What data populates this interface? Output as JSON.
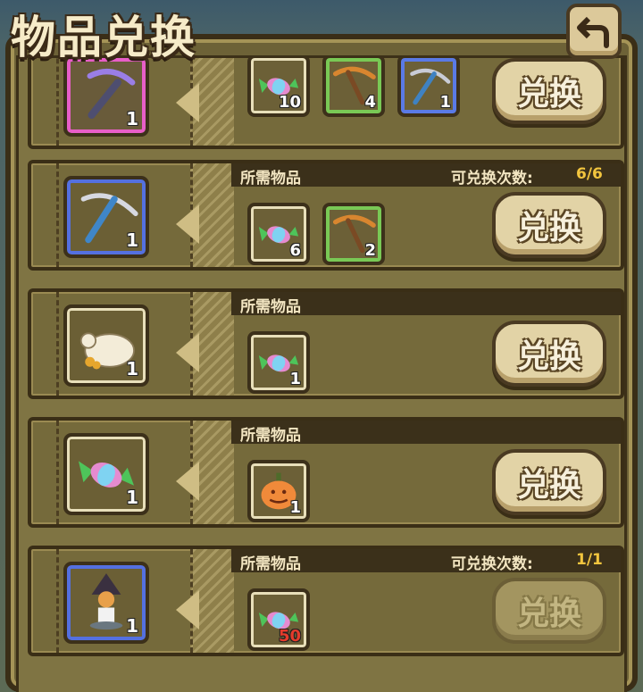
{
  "header": {
    "title": "物品兑换",
    "back_icon": "return-arrow-icon"
  },
  "labels": {
    "required": "所需物品",
    "count_label": "可兑换次数:",
    "exchange": "兑换"
  },
  "rows": [
    {
      "reward": {
        "icon": "purple-pickaxe-icon",
        "qty": "1",
        "rarity": "purple"
      },
      "required": [
        {
          "icon": "candy-icon",
          "qty": "10"
        },
        {
          "icon": "bronze-pickaxe-icon",
          "qty": "4"
        },
        {
          "icon": "blue-pickaxe-icon",
          "qty": "1"
        }
      ],
      "exchange_enabled": true
    },
    {
      "reward": {
        "icon": "blue-pickaxe-icon",
        "qty": "1",
        "rarity": "blue"
      },
      "count_value": "6/6",
      "required": [
        {
          "icon": "candy-icon",
          "qty": "6"
        },
        {
          "icon": "bronze-pickaxe-icon",
          "qty": "2"
        }
      ],
      "exchange_enabled": true
    },
    {
      "reward": {
        "icon": "coin-bag-icon",
        "qty": "1",
        "rarity": "white"
      },
      "required": [
        {
          "icon": "candy-icon",
          "qty": "1"
        }
      ],
      "exchange_enabled": true
    },
    {
      "reward": {
        "icon": "candy-icon",
        "qty": "1",
        "rarity": "white"
      },
      "required": [
        {
          "icon": "pumpkin-icon",
          "qty": "1"
        }
      ],
      "exchange_enabled": true
    },
    {
      "reward": {
        "icon": "witch-figure-icon",
        "qty": "1",
        "rarity": "blue"
      },
      "count_value": "1/1",
      "required": [
        {
          "icon": "candy-icon",
          "qty": "50",
          "insufficient": true
        }
      ],
      "exchange_enabled": false
    }
  ]
}
